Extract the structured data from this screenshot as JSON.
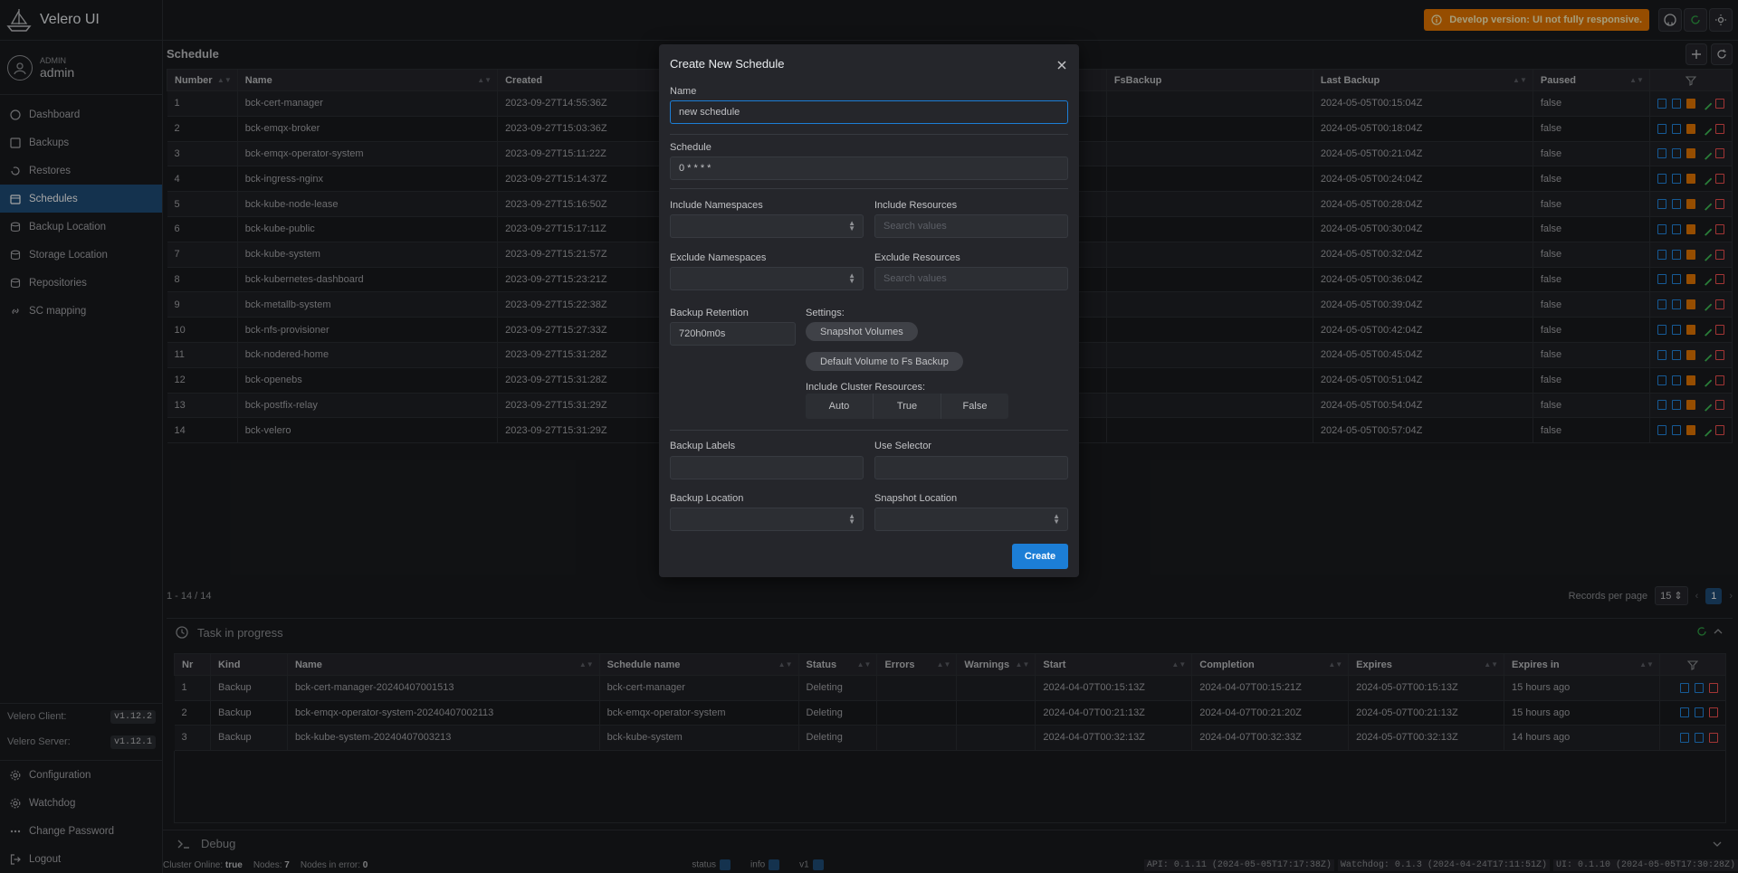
{
  "app": {
    "title": "Velero UI"
  },
  "user": {
    "role": "ADMIN",
    "name": "admin"
  },
  "sidebar": {
    "items": [
      {
        "label": "Dashboard",
        "icon": "home-icon"
      },
      {
        "label": "Backups",
        "icon": "backup-icon"
      },
      {
        "label": "Restores",
        "icon": "restore-icon"
      },
      {
        "label": "Schedules",
        "icon": "calendar-icon"
      },
      {
        "label": "Backup Location",
        "icon": "database-icon"
      },
      {
        "label": "Storage Location",
        "icon": "database-icon"
      },
      {
        "label": "Repositories",
        "icon": "database-icon"
      },
      {
        "label": "SC mapping",
        "icon": "link-icon"
      }
    ],
    "active": "Schedules",
    "client_label": "Velero Client:",
    "client_version": "v1.12.2",
    "server_label": "Velero Server:",
    "server_version": "v1.12.1",
    "bottom_items": [
      {
        "label": "Configuration"
      },
      {
        "label": "Watchdog"
      },
      {
        "label": "Change Password"
      },
      {
        "label": "Logout"
      }
    ]
  },
  "header": {
    "banner": "Develop version: UI not fully responsive."
  },
  "schedule": {
    "title": "Schedule",
    "columns": [
      "Number",
      "Name",
      "Created",
      "FsBackup",
      "Last Backup",
      "Paused"
    ],
    "rows": [
      {
        "number": "1",
        "name": "bck-cert-manager",
        "created": "2023-09-27T14:55:36Z",
        "last": "2024-05-05T00:15:04Z",
        "paused": "false"
      },
      {
        "number": "2",
        "name": "bck-emqx-broker",
        "created": "2023-09-27T15:03:36Z",
        "last": "2024-05-05T00:18:04Z",
        "paused": "false"
      },
      {
        "number": "3",
        "name": "bck-emqx-operator-system",
        "created": "2023-09-27T15:11:22Z",
        "last": "2024-05-05T00:21:04Z",
        "paused": "false"
      },
      {
        "number": "4",
        "name": "bck-ingress-nginx",
        "created": "2023-09-27T15:14:37Z",
        "last": "2024-05-05T00:24:04Z",
        "paused": "false"
      },
      {
        "number": "5",
        "name": "bck-kube-node-lease",
        "created": "2023-09-27T15:16:50Z",
        "last": "2024-05-05T00:28:04Z",
        "paused": "false"
      },
      {
        "number": "6",
        "name": "bck-kube-public",
        "created": "2023-09-27T15:17:11Z",
        "last": "2024-05-05T00:30:04Z",
        "paused": "false"
      },
      {
        "number": "7",
        "name": "bck-kube-system",
        "created": "2023-09-27T15:21:57Z",
        "last": "2024-05-05T00:32:04Z",
        "paused": "false"
      },
      {
        "number": "8",
        "name": "bck-kubernetes-dashboard",
        "created": "2023-09-27T15:23:21Z",
        "last": "2024-05-05T00:36:04Z",
        "paused": "false"
      },
      {
        "number": "9",
        "name": "bck-metallb-system",
        "created": "2023-09-27T15:22:38Z",
        "last": "2024-05-05T00:39:04Z",
        "paused": "false"
      },
      {
        "number": "10",
        "name": "bck-nfs-provisioner",
        "created": "2023-09-27T15:27:33Z",
        "last": "2024-05-05T00:42:04Z",
        "paused": "false"
      },
      {
        "number": "11",
        "name": "bck-nodered-home",
        "created": "2023-09-27T15:31:28Z",
        "last": "2024-05-05T00:45:04Z",
        "paused": "false"
      },
      {
        "number": "12",
        "name": "bck-openebs",
        "created": "2023-09-27T15:31:28Z",
        "last": "2024-05-05T00:51:04Z",
        "paused": "false"
      },
      {
        "number": "13",
        "name": "bck-postfix-relay",
        "created": "2023-09-27T15:31:29Z",
        "last": "2024-05-05T00:54:04Z",
        "paused": "false"
      },
      {
        "number": "14",
        "name": "bck-velero",
        "created": "2023-09-27T15:31:29Z",
        "last": "2024-05-05T00:57:04Z",
        "paused": "false"
      }
    ],
    "range": "1 - 14 / 14",
    "records_label": "Records per page",
    "per_page": "15",
    "page": "1"
  },
  "tasks": {
    "title": "Task in progress",
    "columns": [
      "Nr",
      "Kind",
      "Name",
      "Schedule name",
      "Status",
      "Errors",
      "Warnings",
      "Start",
      "Completion",
      "Expires",
      "Expires in"
    ],
    "rows": [
      {
        "nr": "1",
        "kind": "Backup",
        "name": "bck-cert-manager-20240407001513",
        "schedule": "bck-cert-manager",
        "status": "Deleting",
        "errors": "",
        "warnings": "",
        "start": "2024-04-07T00:15:13Z",
        "completion": "2024-04-07T00:15:21Z",
        "expires": "2024-05-07T00:15:13Z",
        "expires_in": "15 hours ago"
      },
      {
        "nr": "2",
        "kind": "Backup",
        "name": "bck-emqx-operator-system-20240407002113",
        "schedule": "bck-emqx-operator-system",
        "status": "Deleting",
        "errors": "",
        "warnings": "",
        "start": "2024-04-07T00:21:13Z",
        "completion": "2024-04-07T00:21:20Z",
        "expires": "2024-05-07T00:21:13Z",
        "expires_in": "15 hours ago"
      },
      {
        "nr": "3",
        "kind": "Backup",
        "name": "bck-kube-system-20240407003213",
        "schedule": "bck-kube-system",
        "status": "Deleting",
        "errors": "",
        "warnings": "",
        "start": "2024-04-07T00:32:13Z",
        "completion": "2024-04-07T00:32:33Z",
        "expires": "2024-05-07T00:32:13Z",
        "expires_in": "14 hours ago"
      }
    ]
  },
  "debug": {
    "label": "Debug"
  },
  "status": {
    "cluster_online_label": "Cluster Online:",
    "cluster_online": "true",
    "nodes_label": "Nodes:",
    "nodes": "7",
    "nodes_error_label": "Nodes in error:",
    "nodes_error": "0",
    "status_label": "status",
    "info_label": "info",
    "v1_label": "v1",
    "api_version": "API: 0.1.11 (2024-05-05T17:17:38Z)",
    "watchdog_version": "Watchdog: 0.1.3 (2024-04-24T17:11:51Z)",
    "ui_version": "UI: 0.1.10 (2024-05-05T17:30:28Z)"
  },
  "modal": {
    "title": "Create New Schedule",
    "name_label": "Name",
    "name_value": "new schedule",
    "schedule_label": "Schedule",
    "schedule_value": "0 * * * *",
    "include_ns_label": "Include Namespaces",
    "include_res_label": "Include Resources",
    "include_res_placeholder": "Search values",
    "exclude_ns_label": "Exclude Namespaces",
    "exclude_res_label": "Exclude Resources",
    "exclude_res_placeholder": "Search values",
    "retention_label": "Backup Retention",
    "retention_value": "720h0m0s",
    "settings_label": "Settings:",
    "snapshot_volumes": "Snapshot Volumes",
    "default_fs": "Default Volume to Fs Backup",
    "cluster_res_label": "Include Cluster Resources:",
    "cluster_options": [
      "Auto",
      "True",
      "False"
    ],
    "labels_label": "Backup Labels",
    "selector_label": "Use Selector",
    "backup_loc_label": "Backup Location",
    "snapshot_loc_label": "Snapshot Location",
    "create_label": "Create"
  },
  "colors": {
    "accent": "#1c7ed6",
    "active_nav": "#1f4d78",
    "banner": "#e67700"
  }
}
